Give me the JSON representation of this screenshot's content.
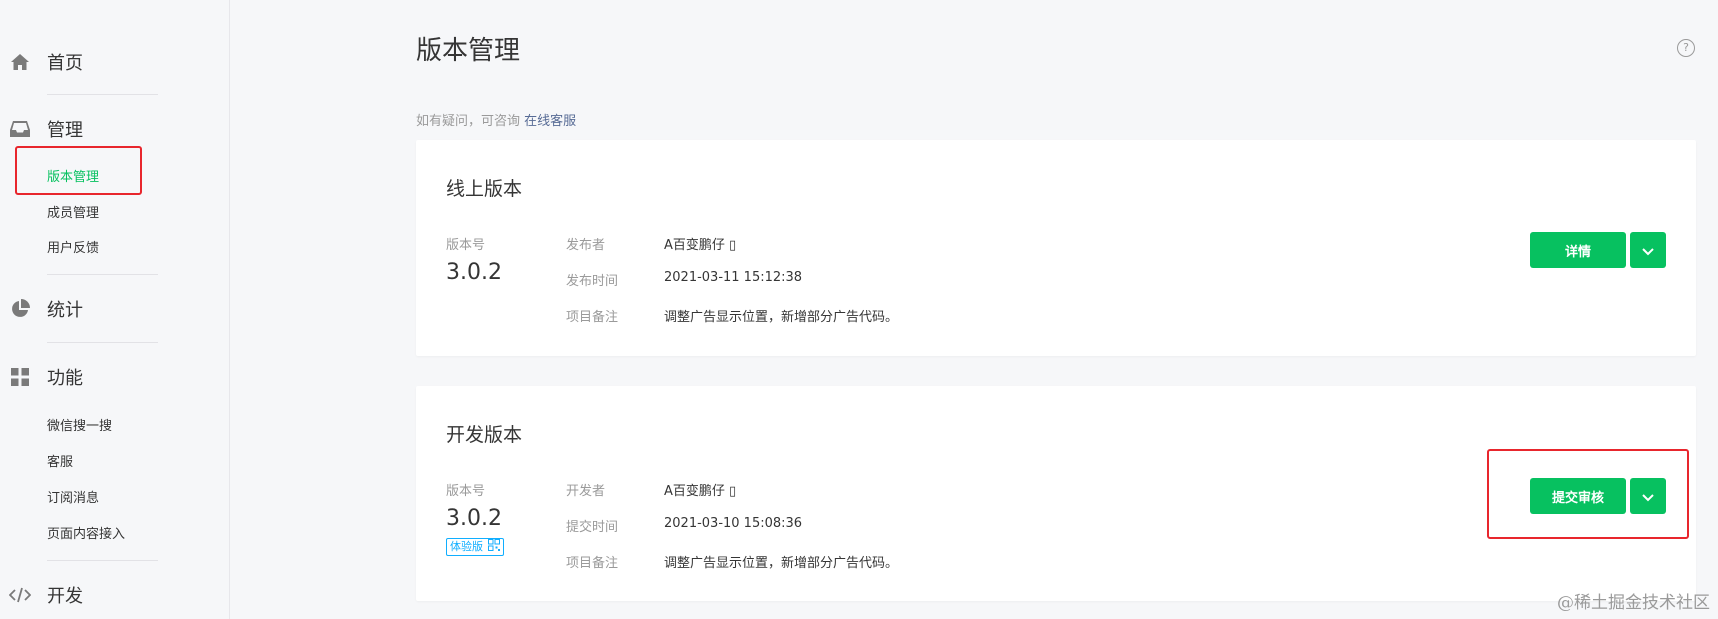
{
  "sidebar": {
    "home": {
      "label": "首页",
      "icon": "home-icon"
    },
    "manage": {
      "label": "管理",
      "icon": "inbox-icon",
      "items": [
        {
          "label": "版本管理",
          "active": true
        },
        {
          "label": "成员管理",
          "active": false
        },
        {
          "label": "用户反馈",
          "active": false
        }
      ]
    },
    "stats": {
      "label": "统计",
      "icon": "pie-chart-icon"
    },
    "features": {
      "label": "功能",
      "icon": "grid-icon",
      "items": [
        {
          "label": "微信搜一搜"
        },
        {
          "label": "客服"
        },
        {
          "label": "订阅消息"
        },
        {
          "label": "页面内容接入"
        }
      ]
    },
    "develop": {
      "label": "开发",
      "icon": "code-icon"
    }
  },
  "main": {
    "title": "版本管理",
    "help_icon": "question-circle-icon",
    "consult_text": "如有疑问，可咨询",
    "consult_link": "在线客服",
    "online": {
      "title": "线上版本",
      "version_label": "版本号",
      "version": "3.0.2",
      "rows": [
        {
          "label": "发布者",
          "value": "A百变鹏仔 ▯"
        },
        {
          "label": "发布时间",
          "value": "2021-03-11 15:12:38"
        },
        {
          "label": "项目备注",
          "value": "调整广告显示位置，新增部分广告代码。"
        }
      ],
      "button": "详情"
    },
    "dev": {
      "title": "开发版本",
      "version_label": "版本号",
      "version": "3.0.2",
      "badge": "体验版",
      "rows": [
        {
          "label": "开发者",
          "value": "A百变鹏仔 ▯"
        },
        {
          "label": "提交时间",
          "value": "2021-03-10 15:08:36"
        },
        {
          "label": "项目备注",
          "value": "调整广告显示位置，新增部分广告代码。"
        }
      ],
      "button": "提交审核"
    }
  },
  "watermark": "@稀土掘金技术社区",
  "colors": {
    "accent_green": "#07c160",
    "highlight_red": "#e8262d",
    "link_blue": "#576b95",
    "badge_blue": "#10aeff"
  }
}
